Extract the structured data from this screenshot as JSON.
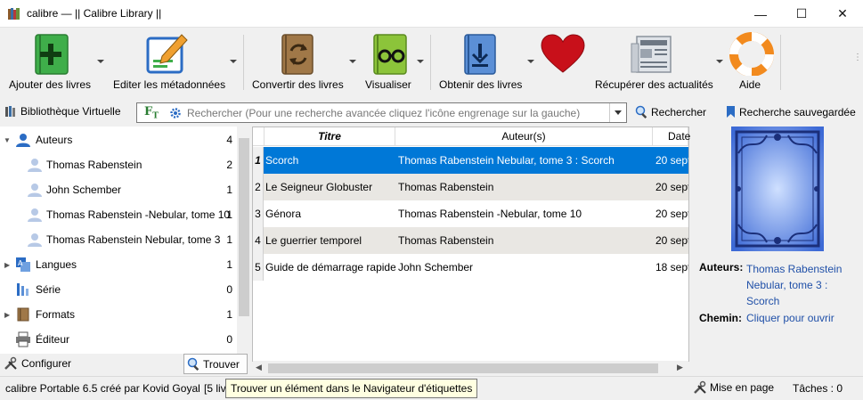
{
  "window": {
    "title": "calibre — || Calibre Library ||",
    "minimize": "—",
    "maximize": "☐",
    "close": "✕"
  },
  "toolbar": {
    "add_books": "Ajouter des livres",
    "edit_metadata": "Editer les métadonnées",
    "convert": "Convertir des livres",
    "view": "Visualiser",
    "get_books": "Obtenir des livres",
    "fetch_news": "Récupérer des actualités",
    "help": "Aide"
  },
  "search": {
    "virtual_library": "Bibliothèque Virtuelle",
    "placeholder": "Rechercher (Pour une recherche avancée cliquez l'icône engrenage sur la gauche)",
    "search_button": "Rechercher",
    "saved_search": "Recherche sauvegardée"
  },
  "tag_browser": {
    "items": [
      {
        "label": "Auteurs",
        "count": "4",
        "icon": "user-icon",
        "expanded": true
      },
      {
        "label": "Thomas Rabenstein",
        "count": "2",
        "icon": "user-light-icon"
      },
      {
        "label": "John Schember",
        "count": "1",
        "icon": "user-light-icon"
      },
      {
        "label": "Thomas Rabenstein -Nebular, tome 10",
        "count": "1",
        "icon": "user-light-icon"
      },
      {
        "label": "Thomas Rabenstein Nebular, tome 3 :",
        "count": "1",
        "icon": "user-light-icon"
      },
      {
        "label": "Langues",
        "count": "1",
        "icon": "language-icon"
      },
      {
        "label": "Série",
        "count": "0",
        "icon": "series-icon"
      },
      {
        "label": "Formats",
        "count": "1",
        "icon": "book-icon"
      },
      {
        "label": "Éditeur",
        "count": "0",
        "icon": "printer-icon"
      }
    ],
    "configure": "Configurer",
    "find": "Trouver"
  },
  "book_list": {
    "columns": [
      "Titre",
      "Auteur(s)",
      "Date"
    ],
    "rows": [
      {
        "num": "1",
        "title": "Scorch",
        "author": "Thomas Rabenstein Nebular, tome 3 : Scorch",
        "date": "20 sept"
      },
      {
        "num": "2",
        "title": "Le Seigneur Globuster",
        "author": "Thomas Rabenstein",
        "date": "20 sept"
      },
      {
        "num": "3",
        "title": "Génora",
        "author": "Thomas Rabenstein -Nebular, tome 10",
        "date": "20 sept"
      },
      {
        "num": "4",
        "title": "Le guerrier temporel",
        "author": "Thomas Rabenstein",
        "date": "20 sept"
      },
      {
        "num": "5",
        "title": "Guide de démarrage rapide",
        "author": "John Schember",
        "date": "18 sept"
      }
    ]
  },
  "details": {
    "authors_label": "Auteurs:",
    "authors_line1": "Thomas Rabenstein",
    "authors_line2": "Nebular, tome 3 :",
    "authors_line3": "Scorch",
    "path_label": "Chemin:",
    "path_value": "Cliquer pour ouvrir"
  },
  "status": {
    "left": "calibre Portable 6.5 créé par Kovid Goyal",
    "books": "[5 liv",
    "tooltip": "Trouver un élément dans le Navigateur d'étiquettes",
    "layout": "Mise en page",
    "jobs": "Tâches : 0"
  },
  "colors": {
    "selection": "#0078d7",
    "link": "#1a0dab",
    "alt_row": "#e9e7e3"
  }
}
